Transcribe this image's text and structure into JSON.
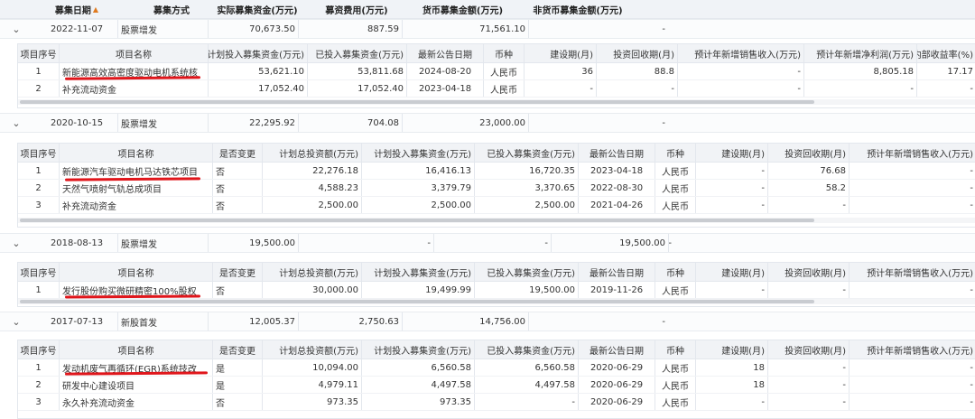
{
  "header": {
    "date": "募集日期",
    "method": "募集方式",
    "actual": "实际募集资金(万元)",
    "fee": "募资费用(万元)",
    "cash": "货币募集金额(万元)",
    "noncash": "非货币募集金额(万元)",
    "sort_icon": "sort-icon"
  },
  "colors": {
    "header_bg": "#f0f3f7",
    "underline": "#e0161b",
    "border": "#e3e7ed"
  },
  "groups": [
    {
      "expand": "⌄",
      "date": "2022-11-07",
      "method": "股票增发",
      "actual": "70,673.50",
      "fee": "887.59",
      "cash": "71,561.10",
      "noncash": "-"
    },
    {
      "expand": "⌄",
      "date": "2020-10-15",
      "method": "股票增发",
      "actual": "22,295.92",
      "fee": "704.08",
      "cash": "23,000.00",
      "noncash": "-"
    },
    {
      "expand": "⌄",
      "date": "2018-08-13",
      "method": "股票增发",
      "actual": "19,500.00",
      "fee": "-",
      "cash": "-",
      "noncash": "19,500.00",
      "extra": "-"
    },
    {
      "expand": "⌄",
      "date": "2017-07-13",
      "method": "新股首发",
      "actual": "12,005.37",
      "fee": "2,750.63",
      "cash": "14,756.00",
      "noncash": "-"
    }
  ],
  "subtable1": {
    "headers": [
      "项目序号",
      "项目名称",
      "计划投入募集资金(万元)",
      "已投入募集资金(万元)",
      "最新公告日期",
      "币种",
      "建设期(月)",
      "投资回收期(月)",
      "预计年新增销售收入(万元)",
      "预计年新增净利润(万元)",
      "内部收益率(%)"
    ],
    "rows": [
      [
        "1",
        "新能源高效高密度驱动电机系统核",
        "53,621.10",
        "53,811.68",
        "2024-08-20",
        "人民币",
        "36",
        "88.8",
        "-",
        "8,805.18",
        "17.17"
      ],
      [
        "2",
        "补充流动资金",
        "17,052.40",
        "17,052.40",
        "2023-04-18",
        "人民币",
        "-",
        "-",
        "-",
        "-",
        "-"
      ]
    ]
  },
  "subtable": {
    "headers": [
      "项目序号",
      "项目名称",
      "是否变更",
      "计划总投资额(万元)",
      "计划投入募集资金(万元)",
      "已投入募集资金(万元)",
      "最新公告日期",
      "币种",
      "建设期(月)",
      "投资回收期(月)",
      "预计年新增销售收入(万元)"
    ]
  },
  "subtable2": {
    "rows": [
      [
        "1",
        "新能源汽车驱动电机马达铁芯项目",
        "否",
        "22,276.18",
        "16,416.13",
        "16,720.35",
        "2023-04-18",
        "人民币",
        "-",
        "76.68",
        "-"
      ],
      [
        "2",
        "天然气喷射气轨总成项目",
        "否",
        "4,588.23",
        "3,379.79",
        "3,370.65",
        "2022-08-30",
        "人民币",
        "-",
        "58.2",
        "-"
      ],
      [
        "3",
        "补充流动资金",
        "否",
        "2,500.00",
        "2,500.00",
        "2,500.00",
        "2021-04-26",
        "人民币",
        "-",
        "-",
        "-"
      ]
    ]
  },
  "subtable3": {
    "rows": [
      [
        "1",
        "发行股份购买微研精密100%股权",
        "否",
        "30,000.00",
        "19,499.99",
        "19,500.00",
        "2019-11-26",
        "人民币",
        "-",
        "-",
        "-"
      ]
    ]
  },
  "subtable4": {
    "rows": [
      [
        "1",
        "发动机废气再循环(EGR)系统技改",
        "是",
        "10,094.00",
        "6,560.58",
        "6,560.58",
        "2020-06-29",
        "人民币",
        "18",
        "-",
        "-"
      ],
      [
        "2",
        "研发中心建设项目",
        "是",
        "4,979.11",
        "4,497.58",
        "4,497.58",
        "2020-06-29",
        "人民币",
        "18",
        "-",
        "-"
      ],
      [
        "3",
        "永久补充流动资金",
        "否",
        "973.35",
        "973.35",
        "-",
        "2020-06-29",
        "人民币",
        "-",
        "-",
        "-"
      ]
    ]
  }
}
